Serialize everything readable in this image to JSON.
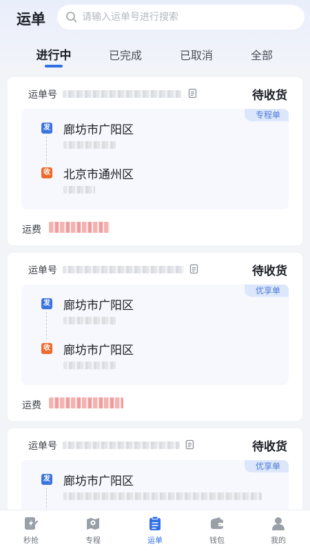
{
  "header": {
    "title": "运单",
    "search": {
      "placeholder": "请输入运单号进行搜索",
      "icon": "search-icon"
    }
  },
  "tabs": [
    {
      "label": "进行中",
      "active": true
    },
    {
      "label": "已完成",
      "active": false
    },
    {
      "label": "已取消",
      "active": false
    },
    {
      "label": "全部",
      "active": false
    }
  ],
  "orders": [
    {
      "waybill_label": "运单号",
      "status": "待收货",
      "type_tag": "专程单",
      "from": {
        "badge": "发",
        "city": "廊坊市广阳区"
      },
      "to": {
        "badge": "收",
        "city": "北京市通州区"
      },
      "fee_label": "运费"
    },
    {
      "waybill_label": "运单号",
      "status": "待收货",
      "type_tag": "优享单",
      "from": {
        "badge": "发",
        "city": "廊坊市广阳区"
      },
      "to": {
        "badge": "收",
        "city": "廊坊市广阳区"
      },
      "fee_label": "运费"
    },
    {
      "waybill_label": "运单号",
      "status": "待收货",
      "type_tag": "优享单",
      "from": {
        "badge": "发",
        "city": "廊坊市广阳区"
      }
    }
  ],
  "tabbar": [
    {
      "label": "秒抢",
      "icon": "grab-order-icon",
      "active": false
    },
    {
      "label": "专程",
      "icon": "map-pin-icon",
      "active": false
    },
    {
      "label": "运单",
      "icon": "clipboard-icon",
      "active": true
    },
    {
      "label": "钱包",
      "icon": "wallet-icon",
      "active": false
    },
    {
      "label": "我的",
      "icon": "user-icon",
      "active": false
    }
  ],
  "colors": {
    "accent": "#2f6fe4",
    "send_badge": "#3d74e0",
    "receive_badge": "#f06a2d",
    "tag_text": "#4a7bd9",
    "tag_bg": "#dde7fb"
  }
}
